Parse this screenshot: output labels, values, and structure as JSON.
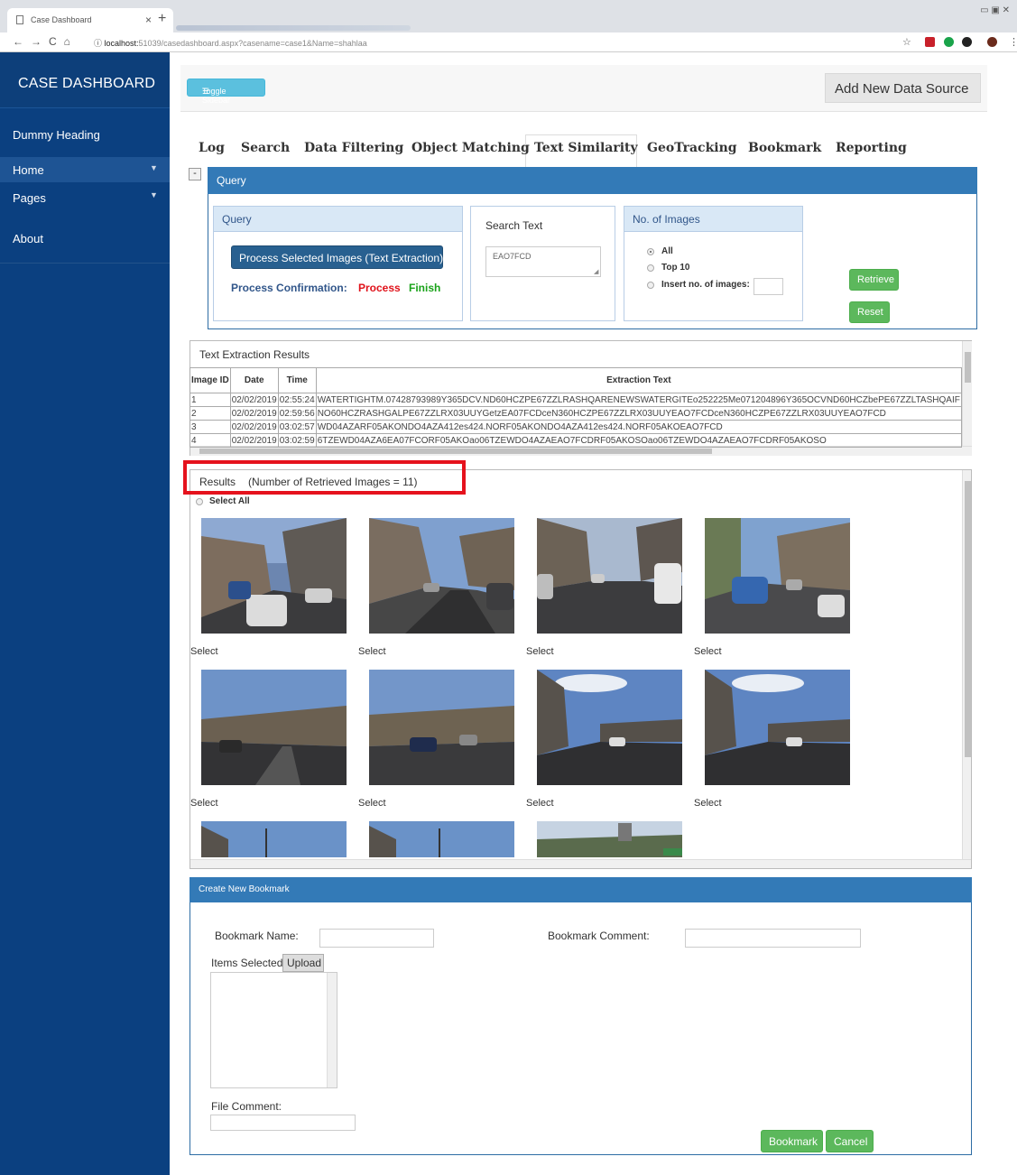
{
  "browser": {
    "tab_title": "Case Dashboard",
    "url_host": "localhost:",
    "url_rest": "51039/casedashboard.aspx?casename=case1&Name=shahlaa"
  },
  "sidebar": {
    "brand": "CASE DASHBOARD",
    "heading": "Dummy Heading",
    "items": [
      {
        "label": "Home",
        "has_submenu": true
      },
      {
        "label": "Pages",
        "has_submenu": true
      },
      {
        "label": "About",
        "has_submenu": false
      }
    ]
  },
  "topbar": {
    "toggle_label": "Toggle Sidebar",
    "add_source_label": "Add New Data Source"
  },
  "tabs": [
    "Log",
    "Search",
    "Data Filtering",
    "Object Matching",
    "Text Similarity",
    "GeoTracking",
    "Bookmark",
    "Reporting"
  ],
  "active_tab": "Text Similarity",
  "query": {
    "panel_title": "Query",
    "collapse_label": "-",
    "inner_title": "Query",
    "process_button": "Process Selected Images (Text Extraction)",
    "confirmation_label": "Process Confirmation:",
    "process_status": "Process",
    "finish_status": "Finish",
    "search_text_title": "Search Text",
    "search_text_value": "EAO7FCD",
    "num_images_title": "No. of Images",
    "options": [
      "All",
      "Top 10",
      "Insert no. of images:"
    ],
    "selected_option": "All",
    "retrieve_button": "Retrieve",
    "reset_button": "Reset"
  },
  "extraction": {
    "title": "Text Extraction Results",
    "columns": [
      "Image ID",
      "Date",
      "Time",
      "Extraction Text"
    ],
    "rows": [
      {
        "id": "1",
        "date": "02/02/2019",
        "time": "02:55:24",
        "text": "WATERTIGHTM.07428793989Y365DCV.ND60HCZPE67ZZLRASHQARENEWSWATERGITEo252225Me071204896Y365OCVND60HCZbePE67ZZLTASHQAIF"
      },
      {
        "id": "2",
        "date": "02/02/2019",
        "time": "02:59:56",
        "text": "NO60HCZRASHGALPE67ZZLRX03UUYGetzEA07FCDceN360HCZPE67ZZLRX03UUYEAO7FCDceN360HCZPE67ZZLRX03UUYEAO7FCD"
      },
      {
        "id": "3",
        "date": "02/02/2019",
        "time": "03:02:57",
        "text": "WD04AZARF05AKONDO4AZA412es424.NORF05AKONDO4AZA412es424.NORF05AKOEAO7FCD"
      },
      {
        "id": "4",
        "date": "02/02/2019",
        "time": "03:02:59",
        "text": "6TZEWD04AZA6EA07FCORF05AKOao06TZEWDO4AZAEAO7FCDRF05AKOSOao06TZEWDO4AZAEAO7FCDRF05AKOSO"
      }
    ]
  },
  "results": {
    "title": "Results",
    "count_text": "(Number of Retrieved Images = 11)",
    "select_all_label": "Select All",
    "select_label": "Select"
  },
  "bookmark": {
    "panel_title": "Create New Bookmark",
    "name_label": "Bookmark Name:",
    "comment_label": "Bookmark Comment:",
    "items_label": "Items Selected",
    "upload_button": "Upload",
    "file_comment_label": "File Comment:",
    "bookmark_button": "Bookmark",
    "cancel_button": "Cancel"
  },
  "colors": {
    "sidebar": "#0b4080",
    "panel_header": "#337ab7",
    "success": "#5cb85c",
    "highlight": "#e5121d",
    "process_red": "#e0121a",
    "finish_green": "#1aa31a"
  }
}
